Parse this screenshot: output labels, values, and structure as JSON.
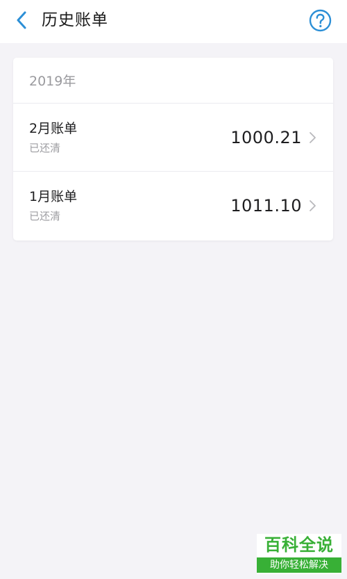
{
  "header": {
    "title": "历史账单",
    "back_icon": "chevron-left-icon",
    "help_icon": "question-circle-icon",
    "accent_color": "#2c8fd6"
  },
  "history": {
    "year_label": "2019年",
    "bills": [
      {
        "name": "2月账单",
        "status": "已还清",
        "amount": "1000.21"
      },
      {
        "name": "1月账单",
        "status": "已还清",
        "amount": "1011.10"
      }
    ]
  },
  "watermark": {
    "title": "百科全说",
    "subtitle": "助你轻松解决",
    "color": "#38b036"
  }
}
